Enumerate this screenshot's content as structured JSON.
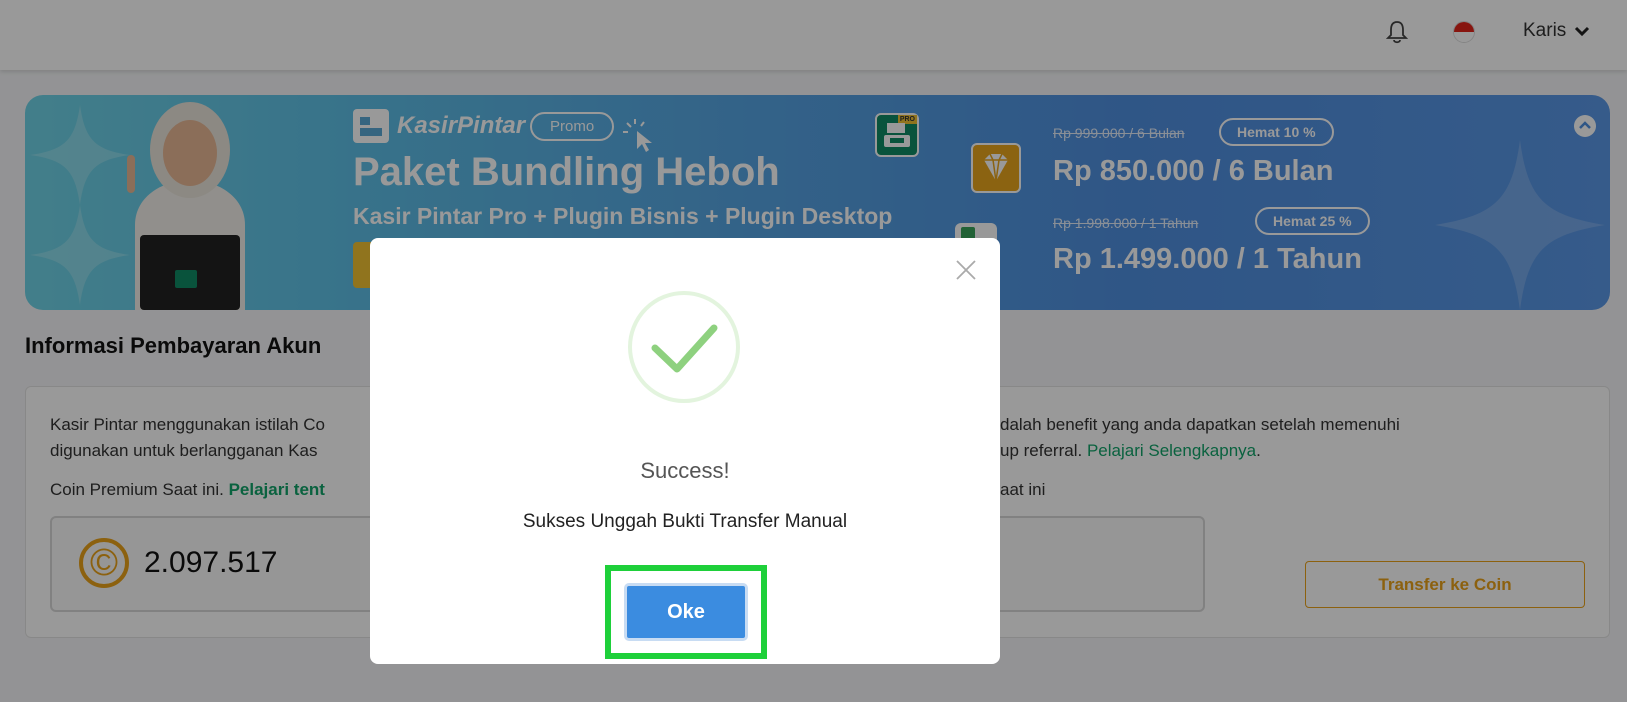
{
  "topbar": {
    "user_name": "Karis"
  },
  "banner": {
    "logo_text": "KasirPintar",
    "promo_label": "Promo",
    "headline": "Paket Bundling Heboh",
    "subheadline": "Kasir Pintar Pro + Plugin Bisnis + Plugin Desktop",
    "offers": [
      {
        "old_price": "Rp 999.000 / 6 Bulan",
        "save": "Hemat 10 %",
        "new_price": "Rp 850.000 / 6 Bulan"
      },
      {
        "old_price": "Rp 1.998.000 / 1 Tahun",
        "save": "Hemat 25 %",
        "new_price": "Rp 1.499.000 / 1 Tahun"
      }
    ],
    "pro_badge": "PRO"
  },
  "section": {
    "title": "Informasi Pembayaran Akun",
    "line1_left": "Kasir Pintar menggunakan istilah Co",
    "line1_right": "dalah benefit yang anda dapatkan setelah memenuhi",
    "line2_left": "digunakan untuk berlangganan Kas",
    "line2_right": " up referral. ",
    "line2_link": "Pelajari Selengkapnya",
    "line3_left": "Coin Premium Saat ini. ",
    "line3_link": "Pelajari tent",
    "line3_right": "aat ini",
    "coin_value": "2.097.517",
    "transfer_button": "Transfer ke Coin"
  },
  "modal": {
    "title": "Success!",
    "message": "Sukses Unggah Bukti Transfer Manual",
    "ok_label": "Oke"
  },
  "colors": {
    "success_green": "#8ed17f",
    "ok_blue": "#3b8ce0",
    "highlight_green": "#1ed03a",
    "brand_green": "#12a36a",
    "coin_orange": "#eaa21a"
  }
}
